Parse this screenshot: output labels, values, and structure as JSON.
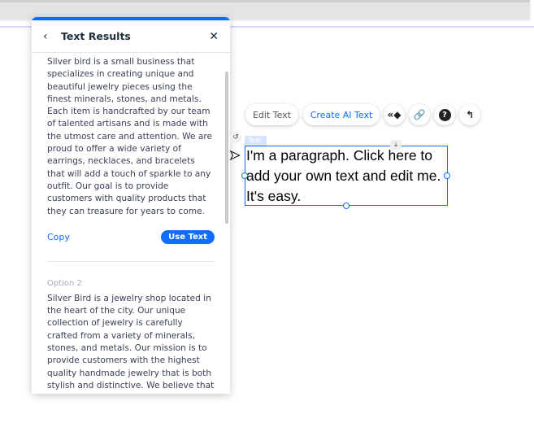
{
  "panel": {
    "title": "Text Results",
    "back_icon": "chevron-left-icon",
    "close_icon": "close-icon",
    "option1": {
      "text": "Silver bird is a small business that specializes in creating unique and beautiful jewelry pieces using the finest minerals, stones, and metals. Each item is handcrafted by our team of talented artisans and is made with the utmost care and attention. We are proud to offer a wide variety of earrings, necklaces, and bracelets that will add a touch of sparkle to any outfit. Our goal is to provide customers with quality products that they can treasure for years to come.",
      "copy": "Copy",
      "use": "Use Text"
    },
    "option2": {
      "label": "Option 2",
      "text": "Silver Bird is a jewelry shop located in the heart of the city. Our unique collection of jewelry is carefully crafted from a variety of minerals, stones, and metals. Our mission is to provide customers with the highest quality handmade jewelry that is both stylish and distinctive. We believe that jewelry"
    }
  },
  "toolbar": {
    "edit": "Edit Text",
    "create_ai": "Create AI Text",
    "ai_color": "#116dff"
  },
  "element": {
    "label": "Text",
    "text": "I'm a paragraph. Click here to add your own text and edit me. It's easy."
  }
}
